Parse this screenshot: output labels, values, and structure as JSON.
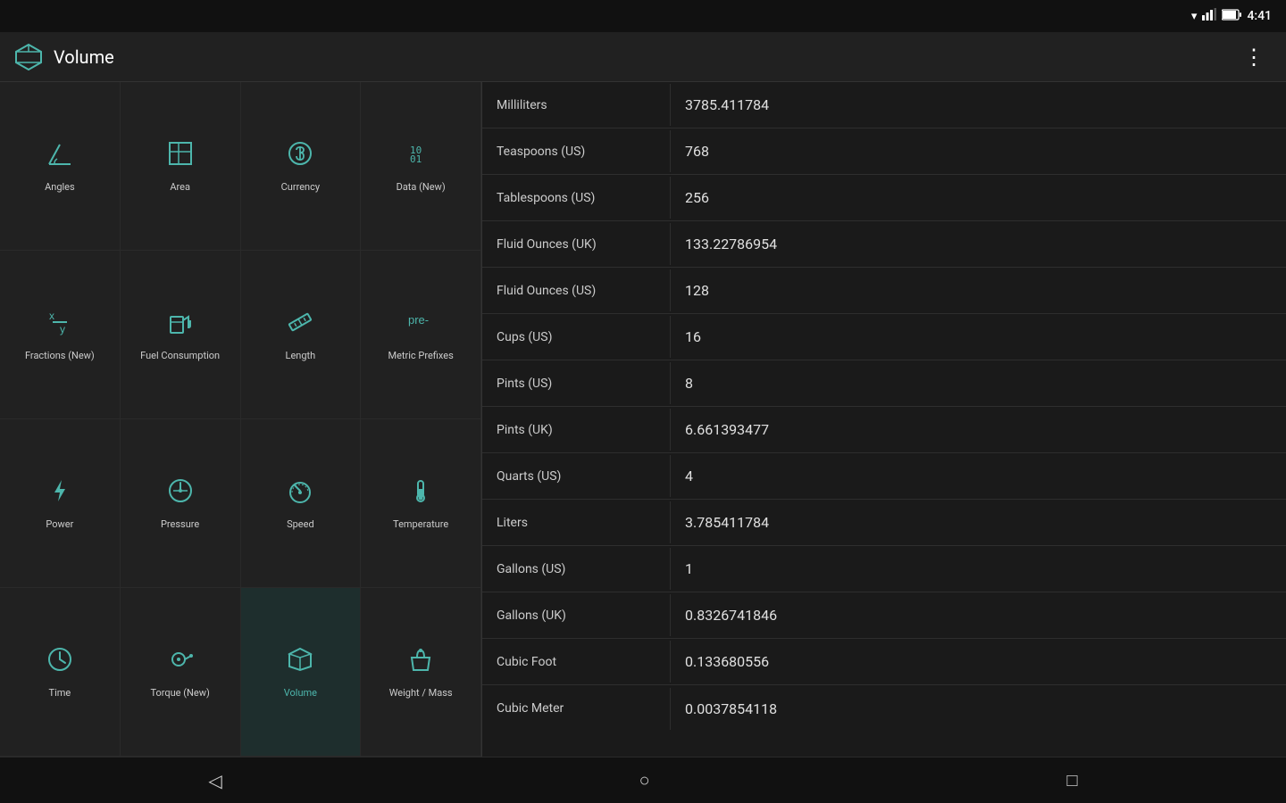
{
  "statusBar": {
    "time": "4:41"
  },
  "appBar": {
    "title": "Volume",
    "menuIcon": "⋮"
  },
  "sidebar": {
    "items": [
      {
        "id": "angles",
        "label": "Angles",
        "icon": "angles"
      },
      {
        "id": "area",
        "label": "Area",
        "icon": "area"
      },
      {
        "id": "currency",
        "label": "Currency",
        "icon": "currency"
      },
      {
        "id": "data-new",
        "label": "Data (New)",
        "icon": "data"
      },
      {
        "id": "fractions",
        "label": "Fractions (New)",
        "icon": "fractions"
      },
      {
        "id": "fuel",
        "label": "Fuel Consumption",
        "icon": "fuel"
      },
      {
        "id": "length",
        "label": "Length",
        "icon": "length"
      },
      {
        "id": "metric",
        "label": "Metric Prefixes",
        "icon": "metric"
      },
      {
        "id": "power",
        "label": "Power",
        "icon": "power"
      },
      {
        "id": "pressure",
        "label": "Pressure",
        "icon": "pressure"
      },
      {
        "id": "speed",
        "label": "Speed",
        "icon": "speed"
      },
      {
        "id": "temperature",
        "label": "Temperature",
        "icon": "temperature"
      },
      {
        "id": "time",
        "label": "Time",
        "icon": "time"
      },
      {
        "id": "torque",
        "label": "Torque (New)",
        "icon": "torque"
      },
      {
        "id": "volume",
        "label": "Volume",
        "icon": "volume"
      },
      {
        "id": "weight",
        "label": "Weight / Mass",
        "icon": "weight"
      }
    ]
  },
  "results": {
    "rows": [
      {
        "label": "Milliliters",
        "value": "3785.411784"
      },
      {
        "label": "Teaspoons (US)",
        "value": "768"
      },
      {
        "label": "Tablespoons (US)",
        "value": "256"
      },
      {
        "label": "Fluid Ounces (UK)",
        "value": "133.22786954"
      },
      {
        "label": "Fluid Ounces (US)",
        "value": "128"
      },
      {
        "label": "Cups (US)",
        "value": "16"
      },
      {
        "label": "Pints (US)",
        "value": "8"
      },
      {
        "label": "Pints (UK)",
        "value": "6.661393477"
      },
      {
        "label": "Quarts (US)",
        "value": "4"
      },
      {
        "label": "Liters",
        "value": "3.785411784"
      },
      {
        "label": "Gallons (US)",
        "value": "1"
      },
      {
        "label": "Gallons (UK)",
        "value": "0.8326741846"
      },
      {
        "label": "Cubic Foot",
        "value": "0.133680556"
      },
      {
        "label": "Cubic Meter",
        "value": "0.0037854118"
      }
    ]
  },
  "bottomNav": {
    "back": "◁",
    "home": "○",
    "recent": "□"
  }
}
